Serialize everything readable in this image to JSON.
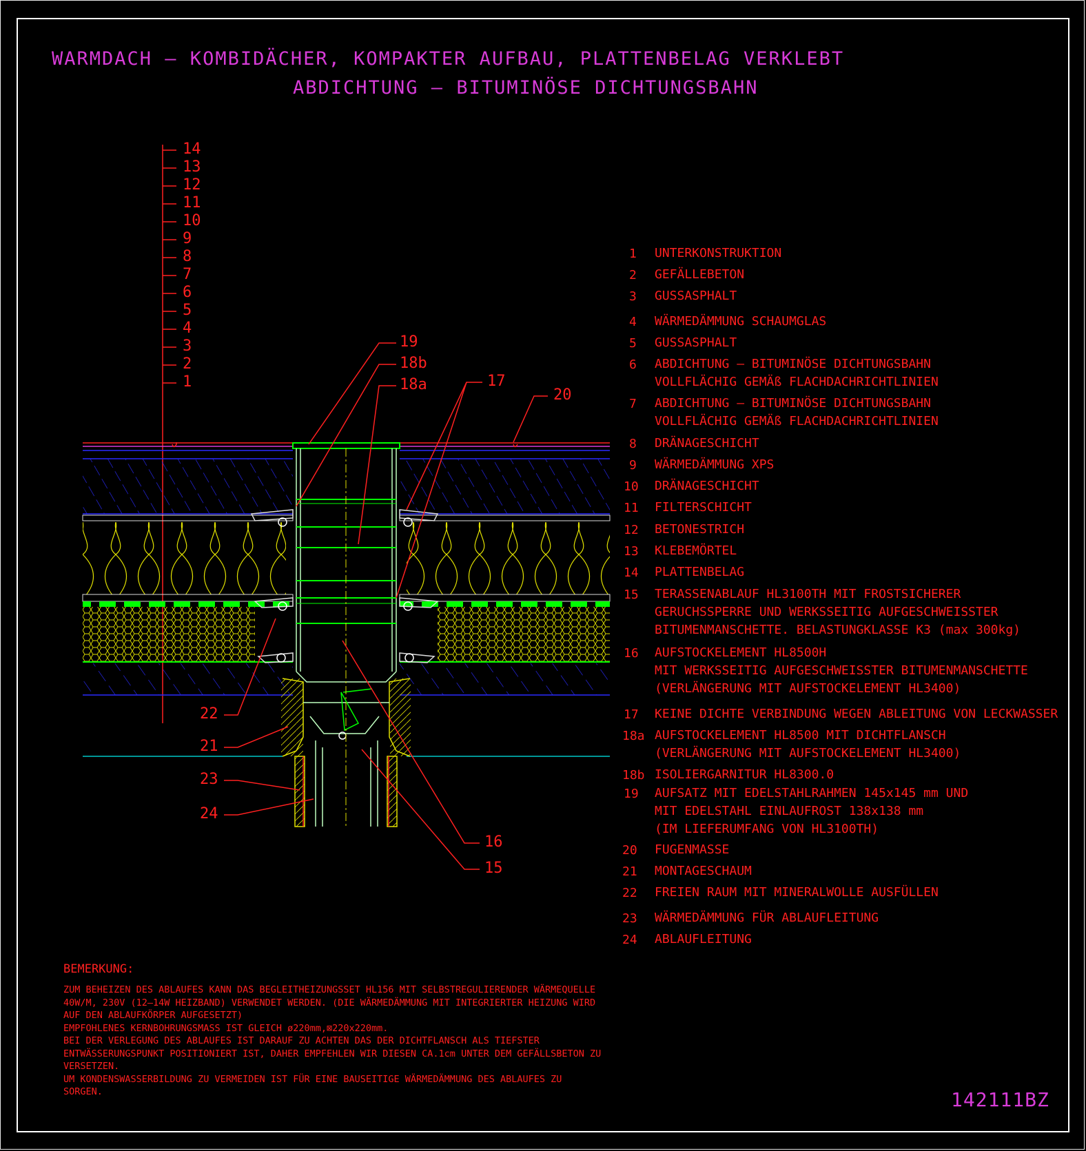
{
  "title": {
    "line1": "WARMDACH – KOMBIDÄCHER, KOMPAKTER AUFBAU, PLATTENBELAG VERKLEBT",
    "line2": "ABDICHTUNG – BITUMINÖSE DICHTUNGSBAHN"
  },
  "layer_scale": [
    "14",
    "13",
    "12",
    "11",
    "10",
    "9",
    "8",
    "7",
    "6",
    "5",
    "4",
    "3",
    "2",
    "1"
  ],
  "callouts": {
    "c19": "19",
    "c18b": "18b",
    "c18a": "18a",
    "c17": "17",
    "c20": "20",
    "c22": "22",
    "c21": "21",
    "c23": "23",
    "c24": "24",
    "c16": "16",
    "c15": "15"
  },
  "legend": [
    {
      "num": "1",
      "text": "UNTERKONSTRUKTION"
    },
    {
      "num": "2",
      "text": "GEFÄLLEBETON"
    },
    {
      "num": "3",
      "text": "GUSSASPHALT"
    },
    {
      "num": "4",
      "text": "WÄRMEDÄMMUNG SCHAUMGLAS"
    },
    {
      "num": "5",
      "text": "GUSSASPHALT"
    },
    {
      "num": "6",
      "text": "ABDICHTUNG – BITUMINÖSE DICHTUNGSBAHN\nVOLLFLÄCHIG GEMÄß FLACHDACHRICHTLINIEN"
    },
    {
      "num": "7",
      "text": "ABDICHTUNG – BITUMINÖSE DICHTUNGSBAHN\nVOLLFLÄCHIG GEMÄß FLACHDACHRICHTLINIEN"
    },
    {
      "num": "8",
      "text": "DRÄNAGESCHICHT"
    },
    {
      "num": "9",
      "text": "WÄRMEDÄMMUNG XPS"
    },
    {
      "num": "10",
      "text": "DRÄNAGESCHICHT"
    },
    {
      "num": "11",
      "text": "FILTERSCHICHT"
    },
    {
      "num": "12",
      "text": "BETONESTRICH"
    },
    {
      "num": "13",
      "text": "KLEBEMÖRTEL"
    },
    {
      "num": "14",
      "text": "PLATTENBELAG"
    },
    {
      "num": "15",
      "text": "TERASSENABLAUF HL3100TH MIT FROSTSICHERER\nGERUCHSSPERRE UND WERKSSEITIG AUFGESCHWEISSTER\nBITUMENMANSCHETTE. BELASTUNGKLASSE K3 (max 300kg)"
    },
    {
      "num": "16",
      "text": "AUFSTOCKELEMENT HL8500H\nMIT WERKSSEITIG AUFGESCHWEISSTER BITUMENMANSCHETTE\n(VERLÄNGERUNG MIT AUFSTOCKELEMENT HL3400)"
    },
    {
      "num": "17",
      "text": "KEINE DICHTE VERBINDUNG WEGEN ABLEITUNG VON LECKWASSER"
    },
    {
      "num": "18a",
      "text": "AUFSTOCKELEMENT HL8500 MIT DICHTFLANSCH\n(VERLÄNGERUNG MIT AUFSTOCKELEMENT HL3400)"
    },
    {
      "num": "18b",
      "text": "ISOLIERGARNITUR HL8300.0"
    },
    {
      "num": "19",
      "text": "AUFSATZ MIT EDELSTAHLRAHMEN 145x145 mm UND\nMIT EDELSTAHL EINLAUFROST 138x138 mm\n(IM LIEFERUMFANG VON HL3100TH)"
    },
    {
      "num": "20",
      "text": "FUGENMASSE"
    },
    {
      "num": "21",
      "text": "MONTAGESCHAUM"
    },
    {
      "num": "22",
      "text": "FREIEN RAUM MIT MINERALWOLLE AUSFÜLLEN"
    },
    {
      "num": "23",
      "text": "WÄRMEDÄMMUNG FÜR ABLAUFLEITUNG"
    },
    {
      "num": "24",
      "text": "ABLAUFLEITUNG"
    }
  ],
  "remark": {
    "heading": "BEMERKUNG:",
    "lines": [
      "ZUM BEHEIZEN DES ABLAUFES KANN DAS BEGLEITHEIZUNGSSET HL156 MIT SELBSTREGULIERENDER WÄRMEQUELLE",
      "40W/M, 230V (12–14W HEIZBAND) VERWENDET WERDEN. (DIE WÄRMEDÄMMUNG MIT INTEGRIERTER HEIZUNG WIRD",
      "AUF DEN ABLAUFKÖRPER AUFGESETZT)",
      "EMPFOHLENES KERNBOHRUNGSMASS IST GLEICH ø220mm,⊠220x220mm.",
      "BEI DER VERLEGUNG DES ABLAUFES IST DARAUF ZU ACHTEN DAS DER DICHTFLANSCH ALS TIEFSTER",
      "ENTWÄSSERUNGSPUNKT POSITIONIERT IST, DAHER EMPFEHLEN WIR DIESEN CA.1cm UNTER DEM GEFÄLLSBETON ZU",
      "VERSETZEN.",
      "UM KONDENSWASSERBILDUNG ZU VERMEIDEN IST FÜR EINE BAUSEITIGE WÄRMEDÄMMUNG DES ABLAUFES ZU",
      "SORGEN."
    ]
  },
  "drawing_number": "142111BZ",
  "colors": {
    "title": "#d83cd8",
    "annotation": "#ff2020",
    "insulation_glass": "#e0e000",
    "membrane": "#00ff00",
    "hatch": "#2020ff",
    "pipe": "#c0ffc0"
  }
}
